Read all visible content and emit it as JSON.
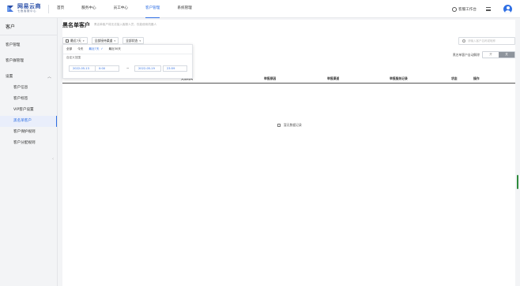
{
  "brand": {
    "title": "网易云商",
    "subtitle": "七鱼客服中心"
  },
  "nav": {
    "items": [
      "首页",
      "服务中心",
      "员工中心",
      "客户管理",
      "系统管理"
    ],
    "active": 3
  },
  "header_right": {
    "workspace": "客服工作台"
  },
  "sidebar": {
    "title": "客户",
    "items": [
      {
        "label": "客户管理"
      },
      {
        "label": "客户群管理"
      },
      {
        "label": "设置"
      },
      {
        "label": "客户信息"
      },
      {
        "label": "客户标签"
      },
      {
        "label": "VIP客户设置"
      },
      {
        "label": "黑名单客户"
      },
      {
        "label": "客户保护规则"
      },
      {
        "label": "客户分配规则"
      }
    ],
    "active": 6,
    "collapse_icon": "chevron-left-icon"
  },
  "page": {
    "title": "黑名单客户",
    "description": "黑名单客户将无法接入客服人员，仅能使用机器人"
  },
  "toolbar": {
    "date_filter": "最近7天",
    "channel_filter": "全部接待渠道",
    "status_filter": "全部状态"
  },
  "search": {
    "placeholder": "请输入客户名称或昵称"
  },
  "auto_lift": {
    "label": "黑名单客户自动解除",
    "off": "开",
    "on": "关"
  },
  "table": {
    "columns": [
      "失效时间",
      "举报原因",
      "举报渠道",
      "举报服务记录",
      "状态",
      "操作"
    ],
    "empty_text": "暂无数据记录"
  },
  "date_dropdown": {
    "quick_options": [
      "全部",
      "今天",
      "最近7天",
      "最近30天"
    ],
    "selected": 2,
    "custom_label": "自定义范围",
    "start_date": "2022-05-13",
    "start_time": "0:00",
    "separator": "~",
    "end_date": "2022-05-19",
    "end_time": "23:59"
  },
  "colors": {
    "accent": "#2f6fe4",
    "scroll_indicator": "#2e8b3c"
  }
}
